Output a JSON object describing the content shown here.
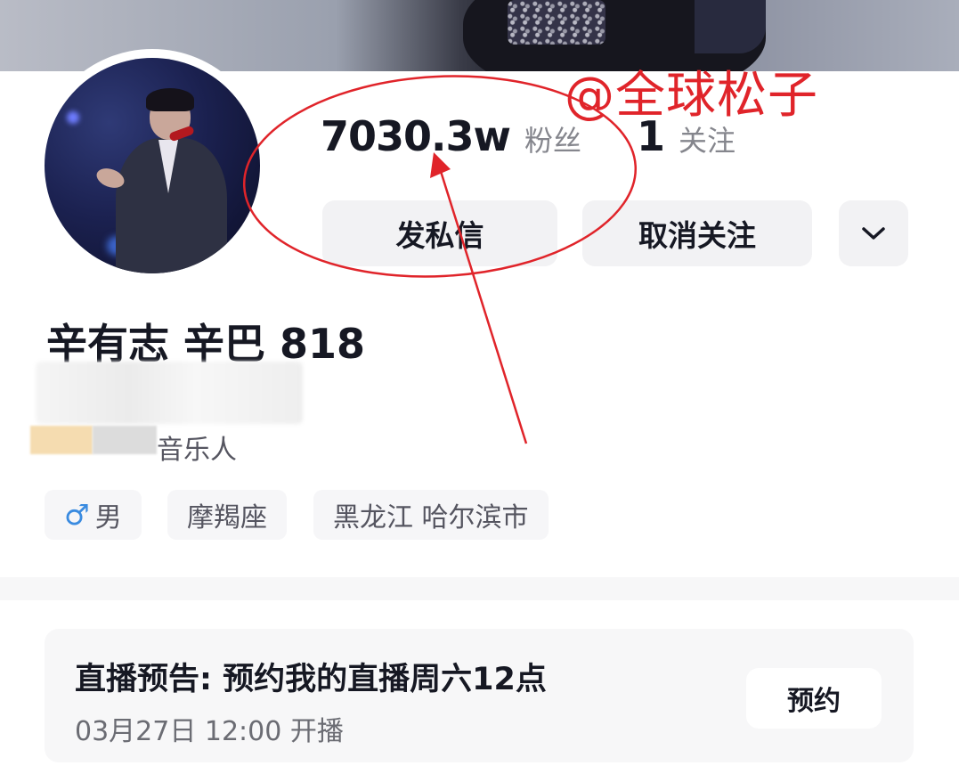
{
  "profile": {
    "name": "辛有志 辛巴 818",
    "role": "音乐人",
    "stats": {
      "followers_value": "7030.3w",
      "followers_label": "粉丝",
      "following_value": "1",
      "following_label": "关注"
    },
    "actions": {
      "message": "发私信",
      "unfollow": "取消关注",
      "more_icon": "chevron-down-icon"
    },
    "tags": {
      "gender_symbol": "♂",
      "gender": "男",
      "zodiac": "摩羯座",
      "location": "黑龙江 哈尔滨市"
    }
  },
  "live_preview": {
    "title": "直播预告: 预约我的直播周六12点",
    "time": "03月27日 12:00 开播",
    "reserve_button": "预约"
  },
  "watermark": "@全球松子",
  "colors": {
    "annotation_red": "#e0242a",
    "gender_blue": "#3a8be0",
    "button_bg": "#f2f2f4"
  }
}
